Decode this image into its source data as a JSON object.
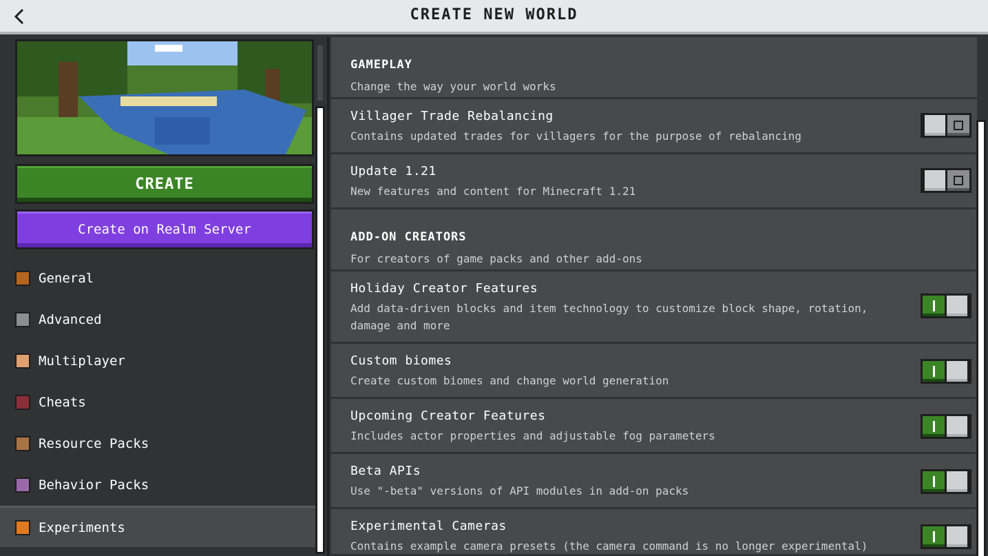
{
  "header": {
    "title": "CREATE NEW WORLD",
    "back_icon": "chevron-left-icon"
  },
  "left": {
    "create_label": "CREATE",
    "realm_label": "Create on Realm Server",
    "nav": [
      {
        "label": "General",
        "icon": "gear-icon",
        "active": false
      },
      {
        "label": "Advanced",
        "icon": "chest-icon",
        "active": false
      },
      {
        "label": "Multiplayer",
        "icon": "player-face-icon",
        "active": false
      },
      {
        "label": "Cheats",
        "icon": "command-block-icon",
        "active": false
      },
      {
        "label": "Resource Packs",
        "icon": "resource-pack-icon",
        "active": false
      },
      {
        "label": "Behavior Packs",
        "icon": "behavior-pack-icon",
        "active": false
      },
      {
        "label": "Experiments",
        "icon": "experiments-icon",
        "active": true
      }
    ]
  },
  "sections": {
    "gameplay": {
      "title": "GAMEPLAY",
      "subtitle": "Change the way your world works"
    },
    "addon": {
      "title": "ADD-ON CREATORS",
      "subtitle": "For creators of game packs and other add-ons"
    }
  },
  "experiments": [
    {
      "title": "Villager Trade Rebalancing",
      "desc": "Contains updated trades for villagers for the purpose of rebalancing",
      "enabled": false
    },
    {
      "title": "Update 1.21",
      "desc": "New features and content for Minecraft 1.21",
      "enabled": false
    },
    {
      "title": "Holiday Creator Features",
      "desc": "Add data-driven blocks and item technology to customize block shape, rotation, damage and more",
      "enabled": true
    },
    {
      "title": "Custom biomes",
      "desc": "Create custom biomes and change world generation",
      "enabled": true
    },
    {
      "title": "Upcoming Creator Features",
      "desc": "Includes actor properties and adjustable fog parameters",
      "enabled": true
    },
    {
      "title": "Beta APIs",
      "desc": "Use \"-beta\" versions of API modules in add-on packs",
      "enabled": true
    },
    {
      "title": "Experimental Cameras",
      "desc": "Contains example camera presets (the camera command is no longer experimental)",
      "enabled": true
    }
  ],
  "colors": {
    "create_green": "#3c8527",
    "realm_purple": "#7f3fe0",
    "panel": "#48494a",
    "background": "#313233"
  }
}
